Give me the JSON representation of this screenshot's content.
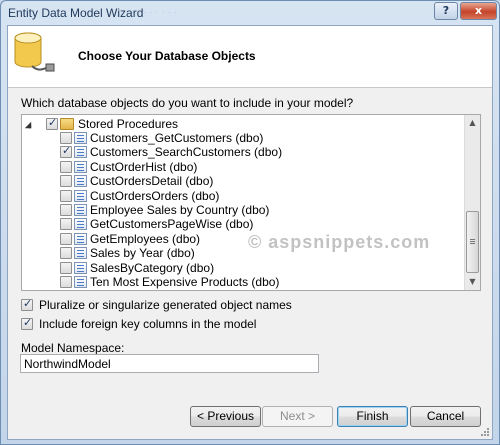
{
  "window": {
    "title": "Entity Data Model Wizard",
    "ghost_title": "· · · · · · · ·",
    "help_label": "?",
    "close_label": "x"
  },
  "header": {
    "title": "Choose Your Database Objects"
  },
  "question": "Which database objects do you want to include in your model?",
  "tree": {
    "root": {
      "label": "Stored Procedures",
      "checked": "partial"
    },
    "items": [
      {
        "label": "Customers_GetCustomers (dbo)",
        "checked": false
      },
      {
        "label": "Customers_SearchCustomers (dbo)",
        "checked": true
      },
      {
        "label": "CustOrderHist (dbo)",
        "checked": false
      },
      {
        "label": "CustOrdersDetail (dbo)",
        "checked": false
      },
      {
        "label": "CustOrdersOrders (dbo)",
        "checked": false
      },
      {
        "label": "Employee Sales by Country (dbo)",
        "checked": false
      },
      {
        "label": "GetCustomersPageWise (dbo)",
        "checked": false
      },
      {
        "label": "GetEmployees (dbo)",
        "checked": false
      },
      {
        "label": "Sales by Year (dbo)",
        "checked": false
      },
      {
        "label": "SalesByCategory (dbo)",
        "checked": false
      },
      {
        "label": "Ten Most Expensive Products (dbo)",
        "checked": false
      }
    ]
  },
  "watermark": "© aspsnippets.com",
  "options": {
    "pluralize": {
      "label": "Pluralize or singularize generated object names",
      "checked": true
    },
    "foreign_keys": {
      "label": "Include foreign key columns in the model",
      "checked": true
    }
  },
  "namespace": {
    "label": "Model Namespace:",
    "value": "NorthwindModel"
  },
  "buttons": {
    "previous": "< Previous",
    "next": "Next >",
    "finish": "Finish",
    "cancel": "Cancel"
  }
}
